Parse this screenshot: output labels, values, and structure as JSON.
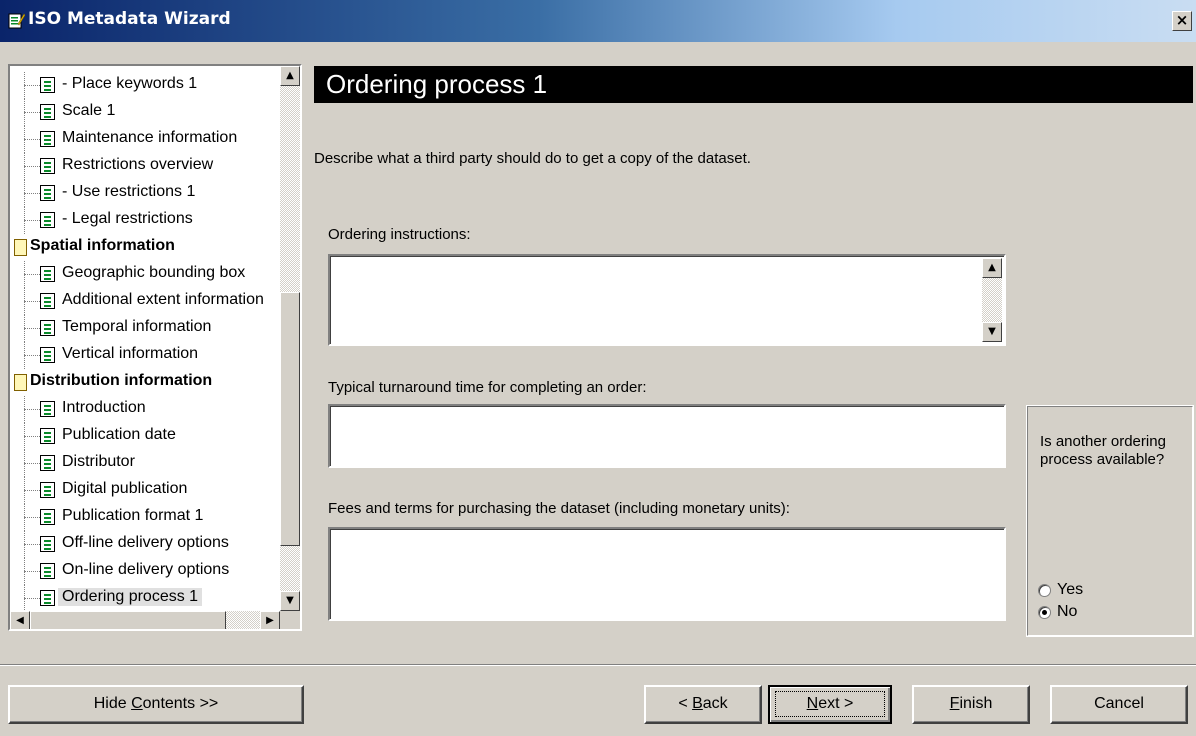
{
  "window": {
    "title": "ISO Metadata Wizard",
    "close_label": "×"
  },
  "tree": {
    "items": [
      {
        "label": "- Place keywords 1",
        "kind": "item"
      },
      {
        "label": "Scale 1",
        "kind": "item"
      },
      {
        "label": "Maintenance information",
        "kind": "item"
      },
      {
        "label": "Restrictions overview",
        "kind": "item"
      },
      {
        "label": "- Use restrictions 1",
        "kind": "item"
      },
      {
        "label": "- Legal restrictions",
        "kind": "item"
      },
      {
        "label": "Spatial information",
        "kind": "section"
      },
      {
        "label": "Geographic bounding box",
        "kind": "item"
      },
      {
        "label": "Additional extent information",
        "kind": "item"
      },
      {
        "label": "Temporal information",
        "kind": "item"
      },
      {
        "label": "Vertical information",
        "kind": "item"
      },
      {
        "label": "Distribution information",
        "kind": "section"
      },
      {
        "label": "Introduction",
        "kind": "item"
      },
      {
        "label": "Publication date",
        "kind": "item"
      },
      {
        "label": "Distributor",
        "kind": "item"
      },
      {
        "label": "Digital publication",
        "kind": "item"
      },
      {
        "label": "Publication format 1",
        "kind": "item"
      },
      {
        "label": "Off-line delivery options",
        "kind": "item"
      },
      {
        "label": "On-line delivery options",
        "kind": "item"
      },
      {
        "label": "Ordering process 1",
        "kind": "item",
        "selected": true
      }
    ]
  },
  "main": {
    "title": "Ordering process 1",
    "description": "Describe what a third party should do to get a copy of the dataset.",
    "fields": {
      "ordering_instructions": {
        "label": "Ordering instructions:",
        "value": ""
      },
      "turnaround": {
        "label": "Typical turnaround time for completing an order:",
        "value": ""
      },
      "fees": {
        "label": "Fees and terms for purchasing the dataset (including monetary units):",
        "value": ""
      }
    },
    "another_process": {
      "question": "Is another ordering process available?",
      "options": [
        {
          "label": "Yes",
          "checked": false
        },
        {
          "label": "No",
          "checked": true
        }
      ]
    }
  },
  "buttons": {
    "hide_contents": {
      "pre": "Hide ",
      "key": "C",
      "post": "ontents >>"
    },
    "back": {
      "pre": "< ",
      "key": "B",
      "post": "ack"
    },
    "next": {
      "pre": "",
      "key": "N",
      "post": "ext >"
    },
    "finish": {
      "pre": "",
      "key": "F",
      "post": "inish"
    },
    "cancel": {
      "label": "Cancel"
    }
  },
  "colors": {
    "title_bar": "#0a246a",
    "face": "#d4d0c8",
    "header_bg": "#000000",
    "icon_green": "#0a8a2a"
  }
}
